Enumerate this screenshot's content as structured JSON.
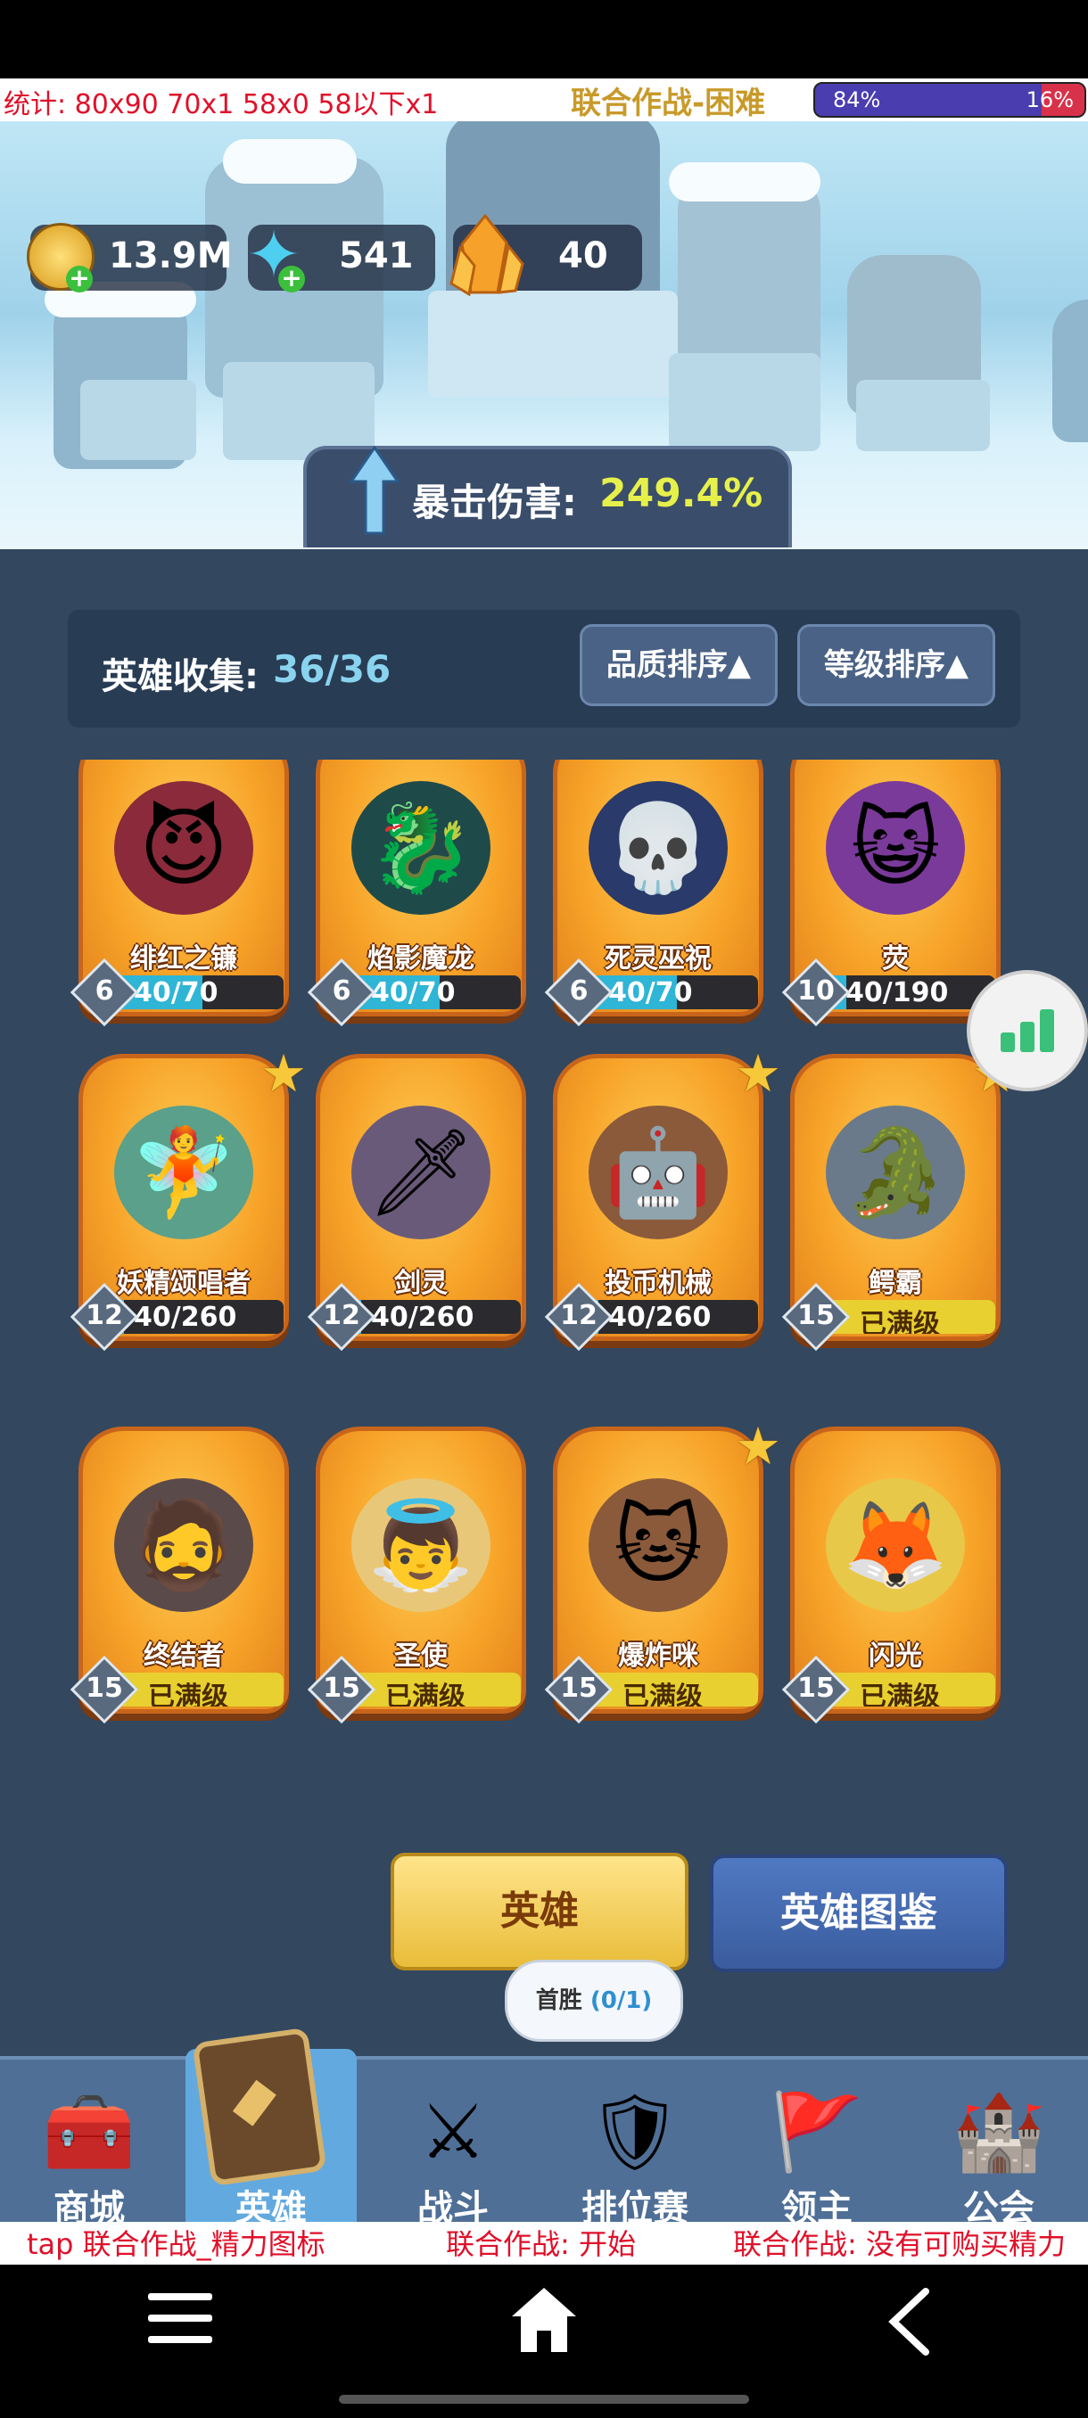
{
  "overlay_top": {
    "stats": "统计: 80x90 70x1 58x0 58以下x1",
    "mode_title": "联合作战-困难",
    "ratio_left": "84%",
    "ratio_right": "16%",
    "ratio_left_fraction": 0.84
  },
  "resources": {
    "gold": "13.9M",
    "gems": "541",
    "crystals": "40"
  },
  "crit": {
    "label": "暴击伤害:",
    "value": "249.4%"
  },
  "collection": {
    "label": "英雄收集:",
    "count": "36/36",
    "sort_quality": "品质排序▲",
    "sort_level": "等级排序▲"
  },
  "heroes": [
    {
      "name": "绯红之镰",
      "level": "6",
      "progress": "40/70",
      "fill": 0.571,
      "max": false,
      "star": false,
      "icon": "😈",
      "bg": "#8a2a3a"
    },
    {
      "name": "焰影魔龙",
      "level": "6",
      "progress": "40/70",
      "fill": 0.571,
      "max": false,
      "star": false,
      "icon": "🐉",
      "bg": "#1f4a4a"
    },
    {
      "name": "死灵巫祝",
      "level": "6",
      "progress": "40/70",
      "fill": 0.571,
      "max": false,
      "star": false,
      "icon": "💀",
      "bg": "#2a3a6a"
    },
    {
      "name": "荧",
      "level": "10",
      "progress": "40/190",
      "fill": 0.21,
      "max": false,
      "star": false,
      "icon": "😺",
      "bg": "#7a3a9a"
    },
    {
      "name": "妖精颂唱者",
      "level": "12",
      "progress": "40/260",
      "fill": 0.154,
      "max": false,
      "star": true,
      "icon": "🧚",
      "bg": "#5aa08a"
    },
    {
      "name": "剑灵",
      "level": "12",
      "progress": "40/260",
      "fill": 0.154,
      "max": false,
      "star": false,
      "icon": "🗡",
      "bg": "#6a5a7a"
    },
    {
      "name": "投币机械",
      "level": "12",
      "progress": "40/260",
      "fill": 0.154,
      "max": false,
      "star": true,
      "icon": "🤖",
      "bg": "#8a5a3a"
    },
    {
      "name": "鳄霸",
      "level": "15",
      "progress": "已满级",
      "fill": 1,
      "max": true,
      "star": true,
      "icon": "🐊",
      "bg": "#6a7a8a"
    },
    {
      "name": "终结者",
      "level": "15",
      "progress": "已满级",
      "fill": 1,
      "max": true,
      "star": false,
      "icon": "🧔",
      "bg": "#5a4a4a"
    },
    {
      "name": "圣使",
      "level": "15",
      "progress": "已满级",
      "fill": 1,
      "max": true,
      "star": false,
      "icon": "👼",
      "bg": "#e8c878"
    },
    {
      "name": "爆炸咪",
      "level": "15",
      "progress": "已满级",
      "fill": 1,
      "max": true,
      "star": true,
      "icon": "🐱",
      "bg": "#8a5a3a"
    },
    {
      "name": "闪光",
      "level": "15",
      "progress": "已满级",
      "fill": 1,
      "max": true,
      "star": false,
      "icon": "🦊",
      "bg": "#e8c848"
    }
  ],
  "buttons": {
    "hero": "英雄",
    "codex": "英雄图鉴"
  },
  "tooltip": {
    "text": "首胜",
    "count": "(0/1)"
  },
  "nav": [
    {
      "label": "商城",
      "icon": "🧰"
    },
    {
      "label": "英雄",
      "icon": "🂠"
    },
    {
      "label": "战斗",
      "icon": "⚔"
    },
    {
      "label": "排位赛",
      "icon": "🛡"
    },
    {
      "label": "领主",
      "icon": "🚩"
    },
    {
      "label": "公会",
      "icon": "🏰"
    }
  ],
  "overlay_bottom": {
    "left": "tap 联合作战_精力图标",
    "middle": "联合作战: 开始",
    "right": "联合作战: 没有可购买精力"
  },
  "icons": {
    "gold": "coin-icon",
    "gems": "gem-icon",
    "crystals": "crystal-icon",
    "crit": "arrow-up-icon",
    "float": "stats-chart-icon",
    "sys_menu": "menu-icon",
    "sys_home": "home-icon",
    "sys_back": "back-icon"
  },
  "colors": {
    "panel": "#33475f",
    "card_orange": "#f7a328",
    "crit_value": "#e6f04a",
    "count_blue": "#8ad3ef",
    "overlay_red": "#e0102a"
  }
}
